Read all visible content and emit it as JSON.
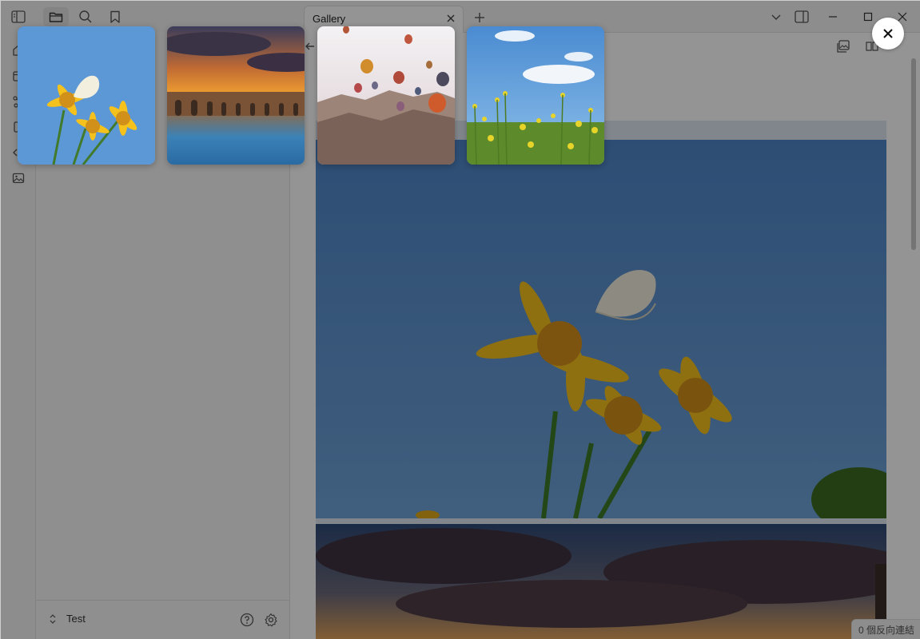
{
  "tab": {
    "title": "Gallery"
  },
  "sidebar": {
    "vault_name": "Test"
  },
  "status_bar": {
    "backlinks": "0 個反向連結"
  },
  "overlay": {
    "thumbnails": [
      {
        "subject": "flowers-butterfly"
      },
      {
        "subject": "sunset-arches"
      },
      {
        "subject": "hot-air-balloons"
      },
      {
        "subject": "rapeseed-field"
      }
    ]
  },
  "icons": {
    "ribbon": [
      "home-icon",
      "calendar-icon",
      "graph-icon",
      "file-icon",
      "code-icon",
      "image-icon"
    ],
    "top": [
      "sidebar-toggle-icon",
      "folder-icon",
      "search-icon",
      "bookmark-icon"
    ]
  }
}
